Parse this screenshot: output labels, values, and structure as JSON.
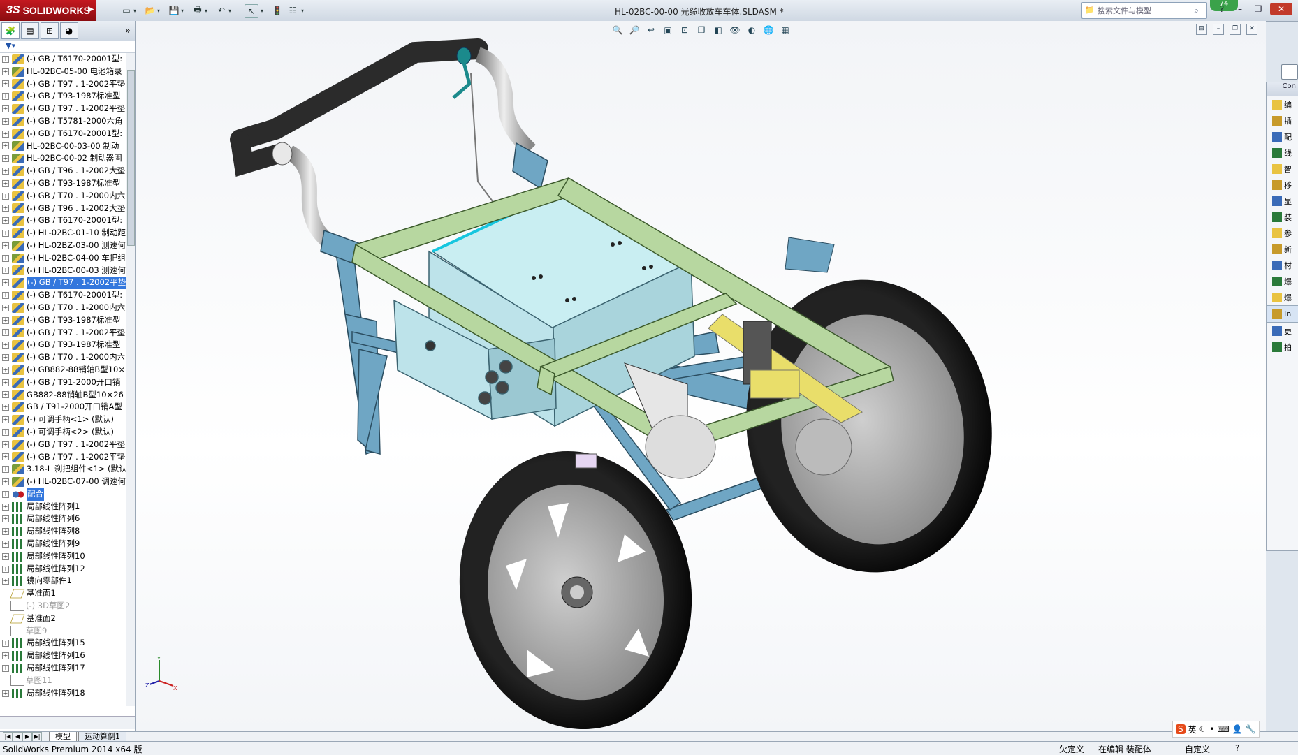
{
  "app": {
    "logo_text": "SOLIDWORKS",
    "window_title": "HL-02BC-00-00 光缆收放车车体.SLDASM *",
    "search_placeholder": "搜索文件与模型",
    "notification_count": "74"
  },
  "left_panel": {
    "tree_items": [
      {
        "label": "(-) GB / T6170-20001型:",
        "icon": "part"
      },
      {
        "label": "HL-02BC-05-00 电池箱录",
        "icon": "asm"
      },
      {
        "label": "(-) GB / T97 . 1-2002平垫",
        "icon": "part"
      },
      {
        "label": "(-) GB / T93-1987标准型",
        "icon": "part"
      },
      {
        "label": "(-) GB / T97 . 1-2002平垫",
        "icon": "part"
      },
      {
        "label": "(-) GB / T5781-2000六角",
        "icon": "part"
      },
      {
        "label": "(-) GB / T6170-20001型:",
        "icon": "part"
      },
      {
        "label": "HL-02BC-00-03-00 制动",
        "icon": "asm"
      },
      {
        "label": "HL-02BC-00-02 制动器固",
        "icon": "asm"
      },
      {
        "label": "(-) GB / T96 . 1-2002大垫",
        "icon": "part"
      },
      {
        "label": "(-) GB / T93-1987标准型",
        "icon": "part"
      },
      {
        "label": "(-) GB / T70 . 1-2000内六",
        "icon": "part"
      },
      {
        "label": "(-) GB / T96 . 1-2002大垫",
        "icon": "part"
      },
      {
        "label": "(-) GB / T6170-20001型:",
        "icon": "part"
      },
      {
        "label": "(-) HL-02BC-01-10 制动距",
        "icon": "part"
      },
      {
        "label": "(-) HL-02BZ-03-00 测速何",
        "icon": "asm"
      },
      {
        "label": "(-) HL-02BC-04-00 车把组",
        "icon": "asm"
      },
      {
        "label": "(-) HL-02BC-00-03 测速何",
        "icon": "part"
      },
      {
        "label": "(-) GB / T97 . 1-2002平垫",
        "icon": "part",
        "selected": true
      },
      {
        "label": "(-) GB / T6170-20001型:",
        "icon": "part"
      },
      {
        "label": "(-) GB / T70 . 1-2000内六",
        "icon": "part"
      },
      {
        "label": "(-) GB / T93-1987标准型",
        "icon": "part"
      },
      {
        "label": "(-) GB / T97 . 1-2002平垫",
        "icon": "part"
      },
      {
        "label": "(-) GB / T93-1987标准型",
        "icon": "part"
      },
      {
        "label": "(-) GB / T70 . 1-2000内六",
        "icon": "part"
      },
      {
        "label": "(-) GB882-88销轴B型10×",
        "icon": "part"
      },
      {
        "label": "(-) GB / T91-2000开口销",
        "icon": "part"
      },
      {
        "label": "GB882-88销轴B型10×26",
        "icon": "part"
      },
      {
        "label": "GB / T91-2000开口销A型",
        "icon": "part"
      },
      {
        "label": "(-) 可调手柄<1> (默认)",
        "icon": "part"
      },
      {
        "label": "(-) 可调手柄<2> (默认)",
        "icon": "part"
      },
      {
        "label": "(-) GB / T97 . 1-2002平垫",
        "icon": "part"
      },
      {
        "label": "(-) GB / T97 . 1-2002平垫",
        "icon": "part"
      },
      {
        "label": "3.18-L 刹把组件<1> (默认",
        "icon": "asm"
      },
      {
        "label": "(-) HL-02BC-07-00 调速何",
        "icon": "asm"
      },
      {
        "label": "配合",
        "icon": "mate",
        "selected": true
      },
      {
        "label": "局部线性阵列1",
        "icon": "pattern"
      },
      {
        "label": "局部线性阵列6",
        "icon": "pattern"
      },
      {
        "label": "局部线性阵列8",
        "icon": "pattern"
      },
      {
        "label": "局部线性阵列9",
        "icon": "pattern"
      },
      {
        "label": "局部线性阵列10",
        "icon": "pattern"
      },
      {
        "label": "局部线性阵列12",
        "icon": "pattern"
      },
      {
        "label": "镜向零部件1",
        "icon": "pattern"
      },
      {
        "label": "基准面1",
        "icon": "plane",
        "noexp": true
      },
      {
        "label": "(-) 3D草图2",
        "icon": "sketch",
        "noexp": true,
        "dim": true
      },
      {
        "label": "基准面2",
        "icon": "plane",
        "noexp": true
      },
      {
        "label": "草图9",
        "icon": "sketch",
        "noexp": true,
        "dim": true
      },
      {
        "label": "局部线性阵列15",
        "icon": "pattern"
      },
      {
        "label": "局部线性阵列16",
        "icon": "pattern"
      },
      {
        "label": "局部线性阵列17",
        "icon": "pattern"
      },
      {
        "label": "草图11",
        "icon": "sketch",
        "noexp": true,
        "dim": true
      },
      {
        "label": "局部线性阵列18",
        "icon": "pattern"
      }
    ]
  },
  "task_pane": {
    "header": "Con",
    "items": [
      "编",
      "插",
      "配",
      "线",
      "智",
      "移",
      "显",
      "装",
      "参",
      "新",
      "材",
      "爆",
      "爆",
      "In",
      "更",
      "拍"
    ]
  },
  "bottom_tabs": [
    "模型",
    "运动算例1"
  ],
  "status": {
    "app_version": "SolidWorks Premium 2014 x64 版",
    "underdefined": "欠定义",
    "editing": "在编辑 装配体",
    "custom": "自定义",
    "ime_lang": "英"
  },
  "colors": {
    "frame_green": "#b7d7a0",
    "frame_blue": "#6fa6c4",
    "box_cyan": "#c9eef2",
    "tire": "#151515",
    "rim": "#a8a8a8",
    "handle_grip": "#2b2b2b"
  }
}
